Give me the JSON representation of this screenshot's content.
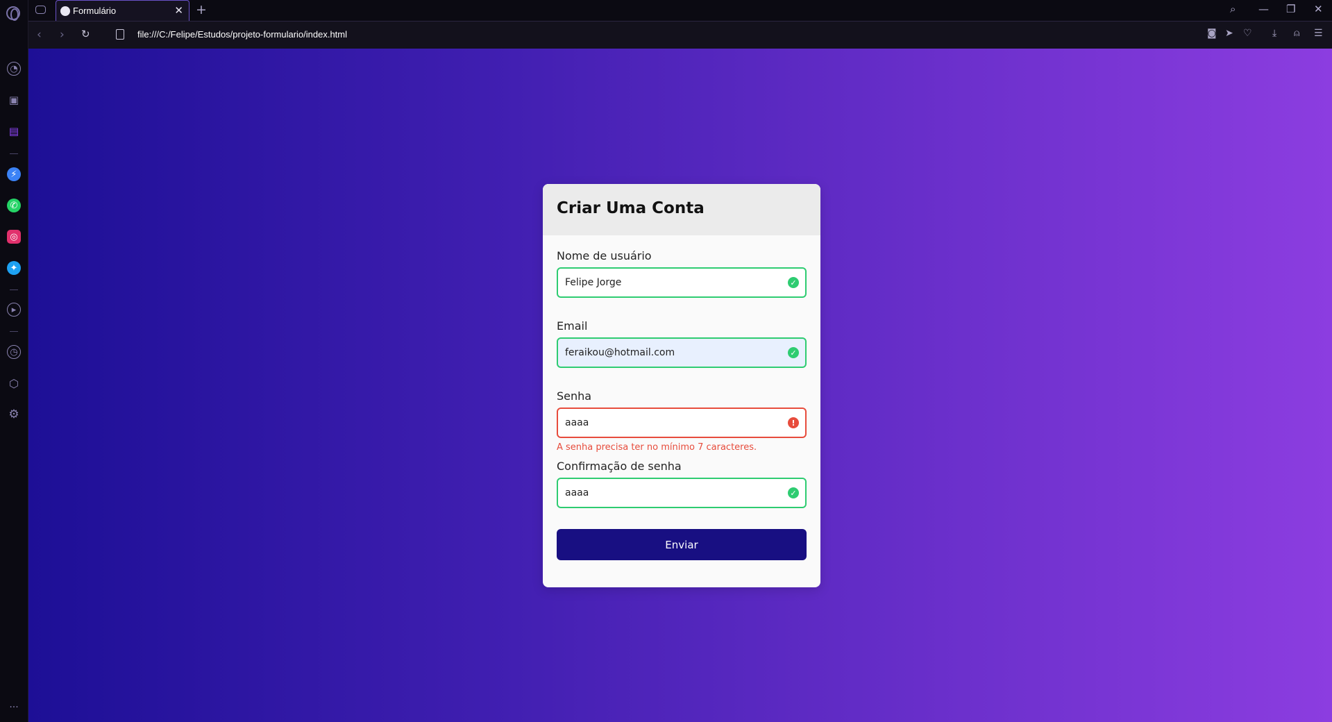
{
  "browser": {
    "tab": {
      "title": "Formulário"
    },
    "address_bar": {
      "url": "file:///C:/Felipe/Estudos/projeto-formulario/index.html"
    }
  },
  "form": {
    "title": "Criar Uma Conta",
    "fields": [
      {
        "label": "Nome de usuário",
        "value": "Felipe Jorge",
        "status": "success"
      },
      {
        "label": "Email",
        "value": "feraikou@hotmail.com",
        "status": "success"
      },
      {
        "label": "Senha",
        "value": "aaaa",
        "status": "error",
        "error_message": "A senha precisa ter no mínimo 7 caracteres."
      },
      {
        "label": "Confirmação de senha",
        "value": "aaaa",
        "status": "success"
      }
    ],
    "submit_label": "Enviar"
  },
  "colors": {
    "success": "#2ecc71",
    "error": "#e74c3c",
    "button": "#180f82",
    "gradient_start": "#1d0f96",
    "gradient_end": "#8c3de0"
  }
}
